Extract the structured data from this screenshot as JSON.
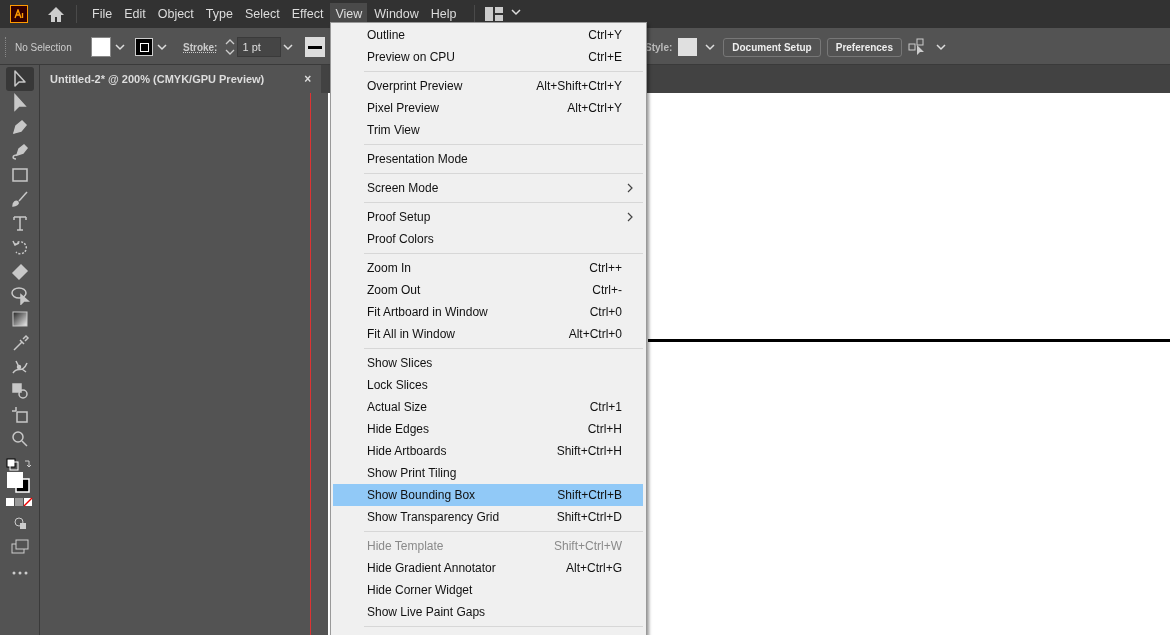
{
  "menu_bar": {
    "items": [
      {
        "label": "File",
        "selected": false
      },
      {
        "label": "Edit",
        "selected": false
      },
      {
        "label": "Object",
        "selected": false
      },
      {
        "label": "Type",
        "selected": false
      },
      {
        "label": "Select",
        "selected": false
      },
      {
        "label": "Effect",
        "selected": false
      },
      {
        "label": "View",
        "selected": true
      },
      {
        "label": "Window",
        "selected": false
      },
      {
        "label": "Help",
        "selected": false
      }
    ]
  },
  "control_bar": {
    "selection": "No Selection",
    "stroke_label": "Stroke:",
    "stroke_weight": "1 pt",
    "style_label": "Style:",
    "buttons": [
      "Document Setup",
      "Preferences"
    ]
  },
  "document_tab": {
    "title": "Untitled-2* @ 200% (CMYK/GPU Preview)",
    "close": "×"
  },
  "tools": [
    {
      "kind": "selection",
      "selected": true
    },
    {
      "kind": "direct",
      "selected": false
    },
    {
      "kind": "pen",
      "selected": false
    },
    {
      "kind": "curvature",
      "selected": false
    },
    {
      "kind": "rectangle",
      "selected": false
    },
    {
      "kind": "brush",
      "selected": false
    },
    {
      "kind": "type",
      "selected": false
    },
    {
      "kind": "rotate",
      "selected": false
    },
    {
      "kind": "eraser",
      "selected": false
    },
    {
      "kind": "lasso",
      "selected": false
    },
    {
      "kind": "gradient",
      "selected": false
    },
    {
      "kind": "eyedropper",
      "selected": false
    },
    {
      "kind": "puppet",
      "selected": false
    },
    {
      "kind": "shapebuilder",
      "selected": false
    },
    {
      "kind": "artboard",
      "selected": false
    },
    {
      "kind": "zoom",
      "selected": false
    }
  ],
  "view_menu": [
    {
      "kind": "item",
      "label": "Outline",
      "shortcut": "Ctrl+Y",
      "submenu": false,
      "disabled": false,
      "selected": false
    },
    {
      "kind": "item",
      "label": "Preview on CPU",
      "shortcut": "Ctrl+E",
      "submenu": false,
      "disabled": false,
      "selected": false
    },
    {
      "kind": "separator"
    },
    {
      "kind": "item",
      "label": "Overprint Preview",
      "shortcut": "Alt+Shift+Ctrl+Y",
      "submenu": false,
      "disabled": false,
      "selected": false
    },
    {
      "kind": "item",
      "label": "Pixel Preview",
      "shortcut": "Alt+Ctrl+Y",
      "submenu": false,
      "disabled": false,
      "selected": false
    },
    {
      "kind": "item",
      "label": "Trim View",
      "submenu": false,
      "disabled": false,
      "selected": false
    },
    {
      "kind": "separator"
    },
    {
      "kind": "item",
      "label": "Presentation Mode",
      "submenu": false,
      "disabled": false,
      "selected": false
    },
    {
      "kind": "separator"
    },
    {
      "kind": "item",
      "label": "Screen Mode",
      "submenu": true,
      "disabled": false,
      "selected": false
    },
    {
      "kind": "separator"
    },
    {
      "kind": "item",
      "label": "Proof Setup",
      "submenu": true,
      "disabled": false,
      "selected": false
    },
    {
      "kind": "item",
      "label": "Proof Colors",
      "submenu": false,
      "disabled": false,
      "selected": false
    },
    {
      "kind": "separator"
    },
    {
      "kind": "item",
      "label": "Zoom In",
      "shortcut": "Ctrl++",
      "submenu": false,
      "disabled": false,
      "selected": false
    },
    {
      "kind": "item",
      "label": "Zoom Out",
      "shortcut": "Ctrl+-",
      "submenu": false,
      "disabled": false,
      "selected": false
    },
    {
      "kind": "item",
      "label": "Fit Artboard in Window",
      "shortcut": "Ctrl+0",
      "submenu": false,
      "disabled": false,
      "selected": false
    },
    {
      "kind": "item",
      "label": "Fit All in Window",
      "shortcut": "Alt+Ctrl+0",
      "submenu": false,
      "disabled": false,
      "selected": false
    },
    {
      "kind": "separator"
    },
    {
      "kind": "item",
      "label": "Show Slices",
      "submenu": false,
      "disabled": false,
      "selected": false
    },
    {
      "kind": "item",
      "label": "Lock Slices",
      "submenu": false,
      "disabled": false,
      "selected": false
    },
    {
      "kind": "item",
      "label": "Actual Size",
      "shortcut": "Ctrl+1",
      "submenu": false,
      "disabled": false,
      "selected": false
    },
    {
      "kind": "item",
      "label": "Hide Edges",
      "shortcut": "Ctrl+H",
      "submenu": false,
      "disabled": false,
      "selected": false
    },
    {
      "kind": "item",
      "label": "Hide Artboards",
      "shortcut": "Shift+Ctrl+H",
      "submenu": false,
      "disabled": false,
      "selected": false
    },
    {
      "kind": "item",
      "label": "Show Print Tiling",
      "submenu": false,
      "disabled": false,
      "selected": false
    },
    {
      "kind": "item",
      "label": "Show Bounding Box",
      "shortcut": "Shift+Ctrl+B",
      "submenu": false,
      "disabled": false,
      "selected": true
    },
    {
      "kind": "item",
      "label": "Show Transparency Grid",
      "shortcut": "Shift+Ctrl+D",
      "submenu": false,
      "disabled": false,
      "selected": false
    },
    {
      "kind": "separator"
    },
    {
      "kind": "item",
      "label": "Hide Template",
      "shortcut": "Shift+Ctrl+W",
      "submenu": false,
      "disabled": true,
      "selected": false
    },
    {
      "kind": "item",
      "label": "Hide Gradient Annotator",
      "shortcut": "Alt+Ctrl+G",
      "submenu": false,
      "disabled": false,
      "selected": false
    },
    {
      "kind": "item",
      "label": "Hide Corner Widget",
      "submenu": false,
      "disabled": false,
      "selected": false
    },
    {
      "kind": "item",
      "label": "Show Live Paint Gaps",
      "submenu": false,
      "disabled": false,
      "selected": false
    },
    {
      "kind": "separator"
    }
  ]
}
